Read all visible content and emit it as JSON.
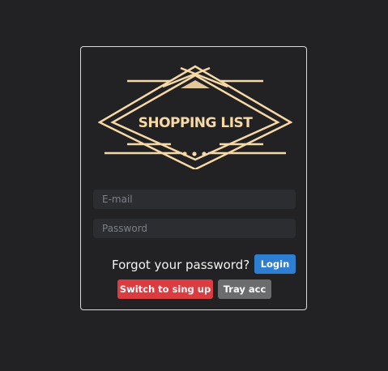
{
  "logo": {
    "text": "SHOPPING LIST",
    "color": "#f6d9a6"
  },
  "form": {
    "email_placeholder": "E-mail",
    "password_placeholder": "Password",
    "forgot_text": "Forgot your password?",
    "login_label": "Login",
    "switch_label": "Switch to sing up",
    "try_label": "Tray acc"
  },
  "colors": {
    "background": "#222224",
    "card_border": "#d8d8d8",
    "input_bg": "#2c2d30",
    "login": "#2e7fd2",
    "switch": "#db3c40",
    "try": "#6b6c6e"
  }
}
